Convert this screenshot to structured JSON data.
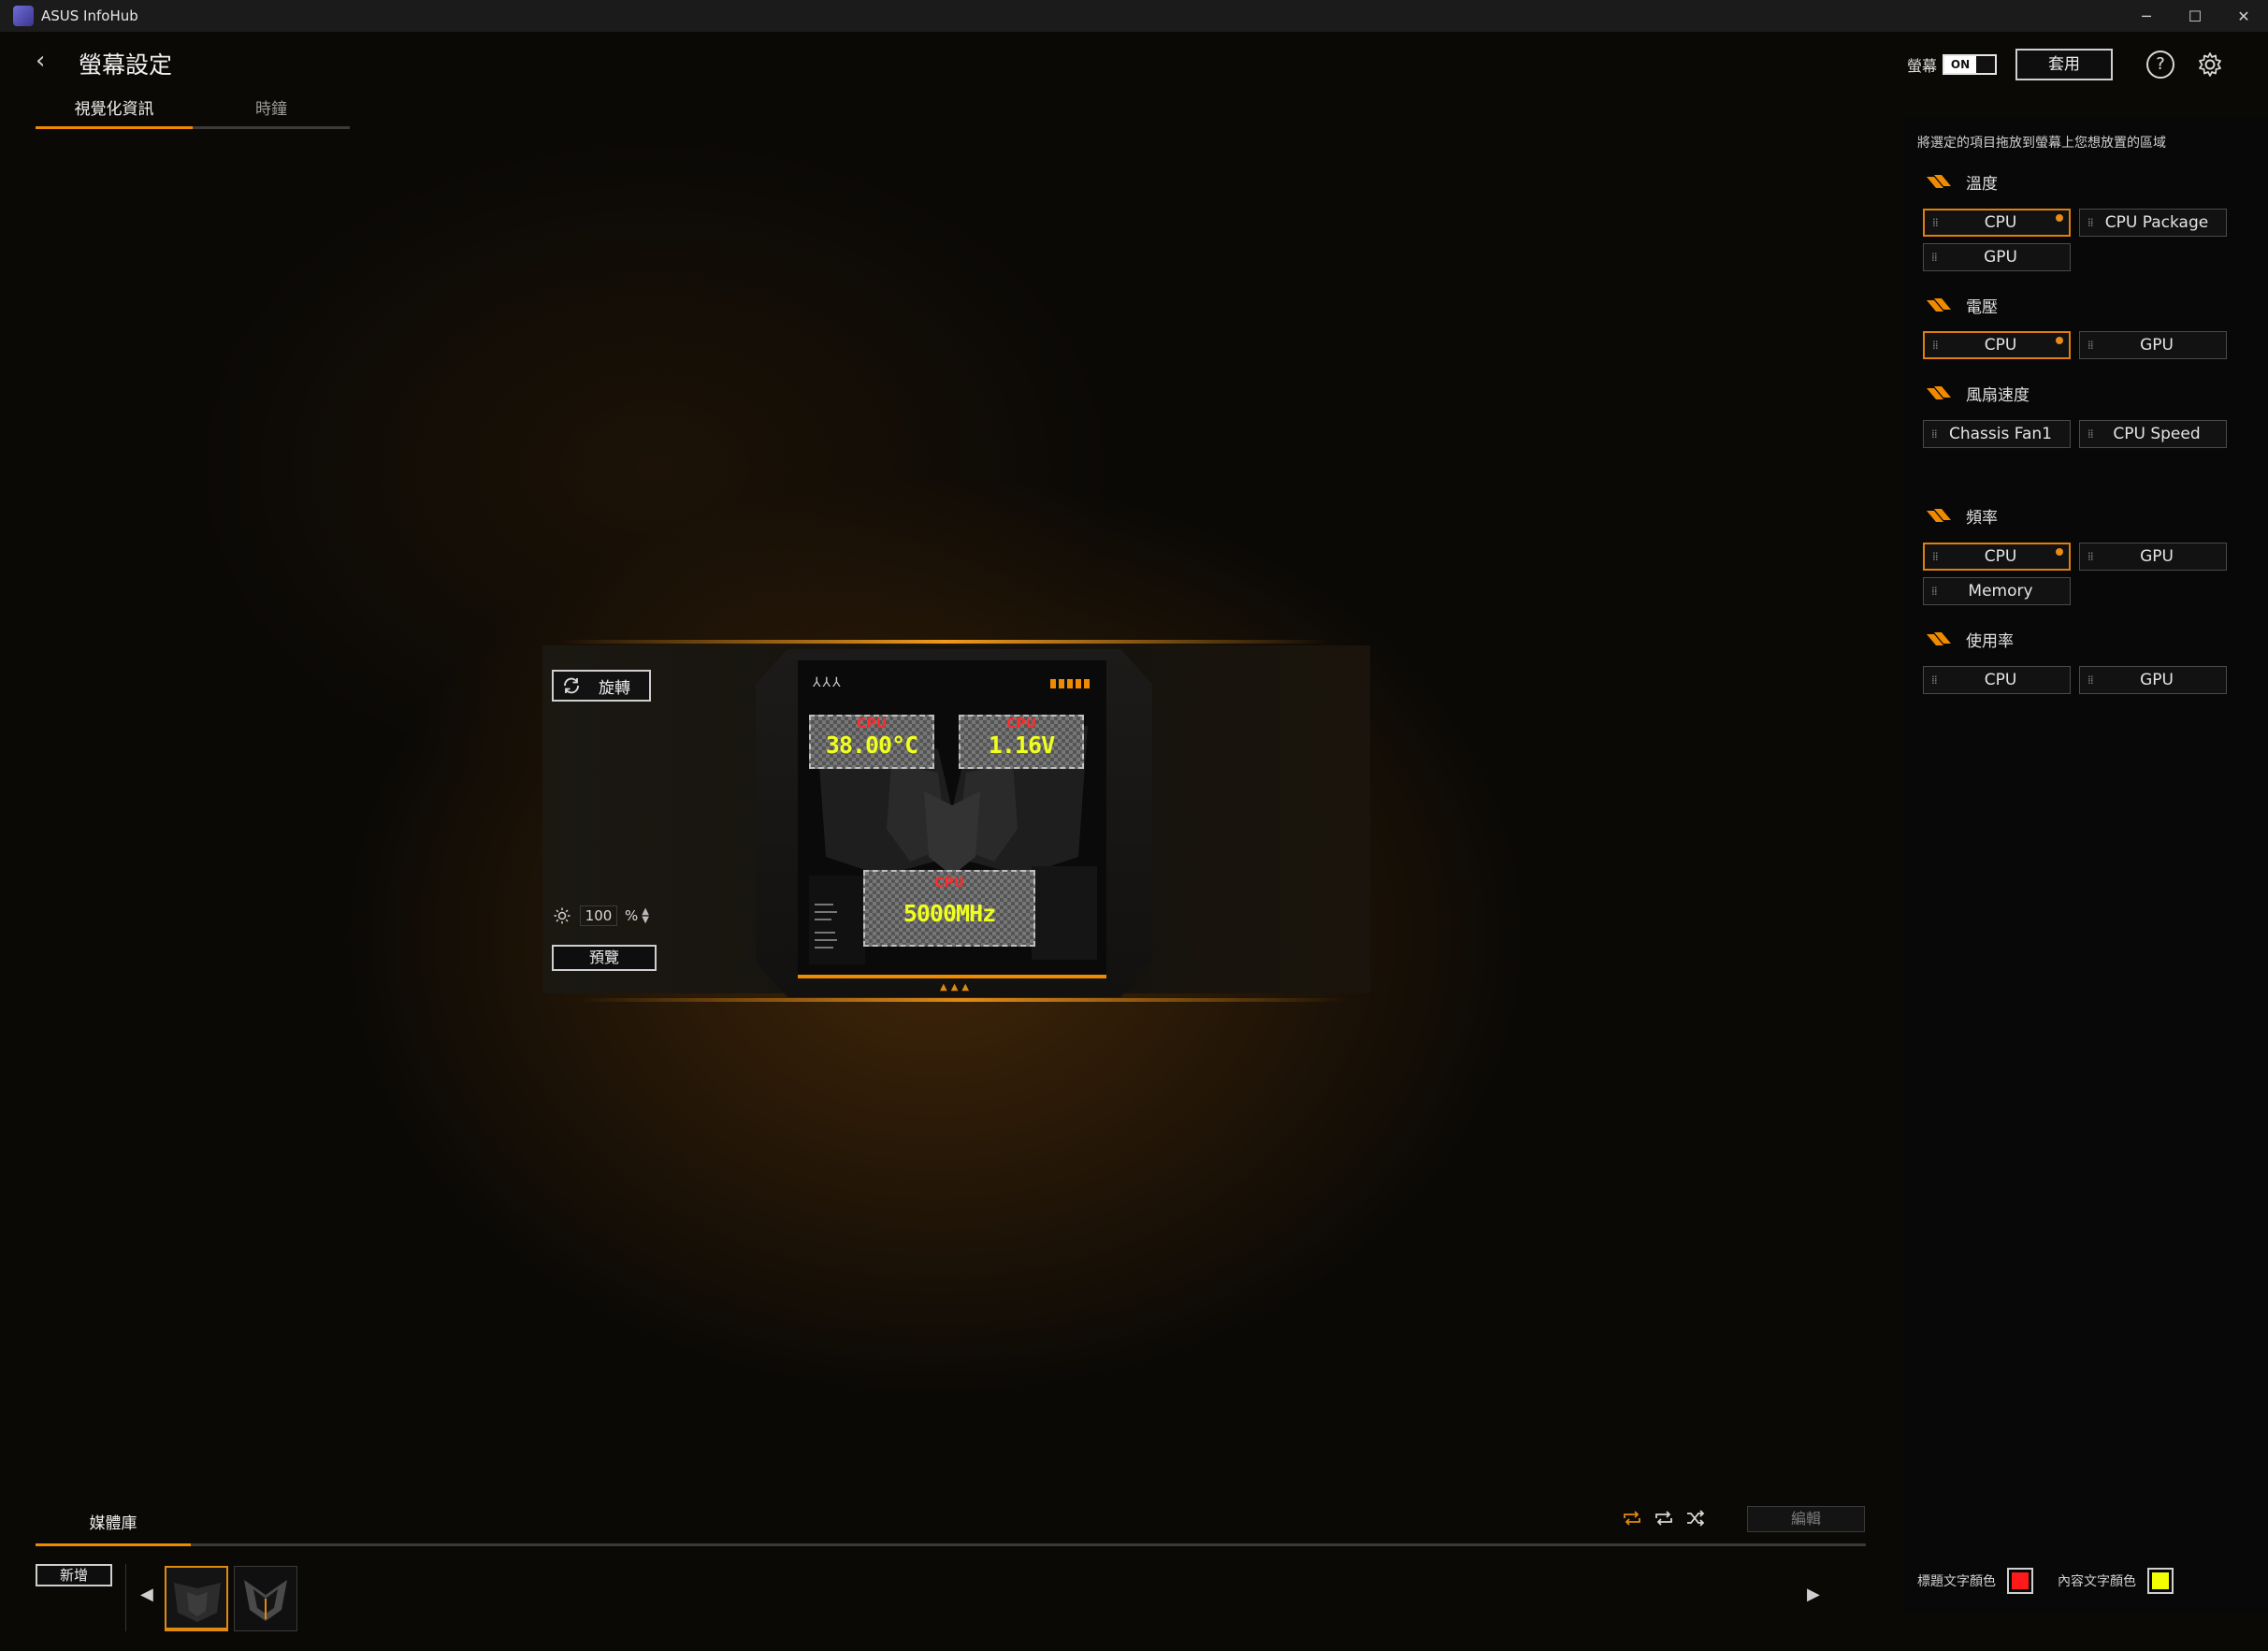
{
  "window": {
    "title": "ASUS InfoHub",
    "controls": {
      "minimize": "─",
      "maximize": "☐",
      "close": "✕"
    }
  },
  "header": {
    "title": "螢幕設定",
    "back_icon": "‹",
    "screen_label": "螢幕",
    "toggle_state": "ON",
    "apply_label": "套用",
    "help_label": "?"
  },
  "tabs": [
    {
      "label": "視覺化資訊",
      "active": true
    },
    {
      "label": "時鐘",
      "active": false
    }
  ],
  "panel": {
    "hint": "將選定的項目拖放到螢幕上您想放置的區域",
    "sections": [
      {
        "title": "溫度",
        "items": [
          {
            "label": "CPU",
            "selected": true
          },
          {
            "label": "CPU Package",
            "selected": false
          },
          {
            "label": "GPU",
            "selected": false
          }
        ]
      },
      {
        "title": "電壓",
        "items": [
          {
            "label": "CPU",
            "selected": true
          },
          {
            "label": "GPU",
            "selected": false
          }
        ]
      },
      {
        "title": "風扇速度",
        "items": [
          {
            "label": "Chassis Fan1",
            "selected": false
          },
          {
            "label": "CPU Speed",
            "selected": false
          }
        ]
      },
      {
        "title": "頻率",
        "items": [
          {
            "label": "CPU",
            "selected": true
          },
          {
            "label": "GPU",
            "selected": false
          },
          {
            "label": "Memory",
            "selected": false
          }
        ]
      },
      {
        "title": "使用率",
        "items": [
          {
            "label": "CPU",
            "selected": false
          },
          {
            "label": "GPU",
            "selected": false
          }
        ]
      }
    ],
    "title_color_label": "標題文字顏色",
    "title_color": "#ff1a1a",
    "content_color_label": "內容文字顏色",
    "content_color": "#f2ff00"
  },
  "preview": {
    "rotate_label": "旋轉",
    "brightness_value": "100",
    "brightness_unit": "%",
    "preview_label": "預覽",
    "metrics": [
      {
        "title": "CPU",
        "value": "38.00°C"
      },
      {
        "title": "CPU",
        "value": "1.16V"
      },
      {
        "title": "CPU",
        "value": "5000MHz"
      }
    ]
  },
  "media": {
    "tab_label": "媒體庫",
    "add_label": "新增",
    "edit_label": "編輯"
  },
  "icons": {
    "accent": "#f08a00",
    "section_icon": "stripes-icon",
    "rotate": "rotate-icon",
    "brightness": "sun-icon",
    "repeat_one": "repeat-one-icon",
    "repeat": "repeat-icon",
    "shuffle": "shuffle-icon"
  }
}
